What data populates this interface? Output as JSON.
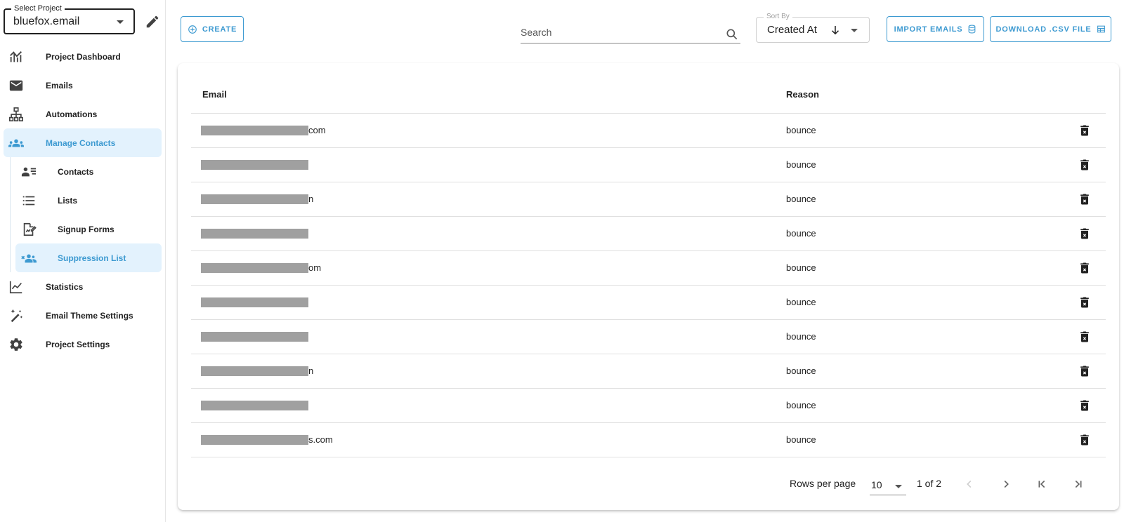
{
  "sidebar": {
    "project_select": {
      "label": "Select Project",
      "value": "bluefox.email"
    },
    "items": [
      {
        "label": "Project Dashboard",
        "icon": "chart-icon"
      },
      {
        "label": "Emails",
        "icon": "mail-icon"
      },
      {
        "label": "Automations",
        "icon": "sitemap-icon"
      },
      {
        "label": "Manage Contacts",
        "icon": "people-icon"
      },
      {
        "label": "Statistics",
        "icon": "line-chart-icon"
      },
      {
        "label": "Email Theme Settings",
        "icon": "magic-wand-icon"
      },
      {
        "label": "Project Settings",
        "icon": "gear-icon"
      }
    ],
    "sub_items": [
      {
        "label": "Contacts",
        "icon": "contact-list-icon"
      },
      {
        "label": "Lists",
        "icon": "list-icon"
      },
      {
        "label": "Signup Forms",
        "icon": "form-icon"
      },
      {
        "label": "Suppression List",
        "icon": "people-remove-icon"
      }
    ]
  },
  "toolbar": {
    "create_label": "CREATE",
    "search_placeholder": "Search",
    "sort": {
      "label": "Sort By",
      "value": "Created At"
    },
    "import_label": "IMPORT EMAILS",
    "download_label": "DOWNLOAD .CSV FILE"
  },
  "table": {
    "columns": {
      "email": "Email",
      "reason": "Reason"
    },
    "rows": [
      {
        "email_tail": "com",
        "reason": "bounce"
      },
      {
        "email_tail": "",
        "reason": "bounce"
      },
      {
        "email_tail": "n",
        "reason": "bounce"
      },
      {
        "email_tail": "",
        "reason": "bounce"
      },
      {
        "email_tail": "om",
        "reason": "bounce"
      },
      {
        "email_tail": "",
        "reason": "bounce"
      },
      {
        "email_tail": "",
        "reason": "bounce"
      },
      {
        "email_tail": "n",
        "reason": "bounce"
      },
      {
        "email_tail": "",
        "reason": "bounce"
      },
      {
        "email_tail": "s.com",
        "reason": "bounce"
      }
    ]
  },
  "pagination": {
    "rows_per_page_label": "Rows per page",
    "rows_per_page_value": "10",
    "range": "1 of 2"
  },
  "colors": {
    "accent": "#3d9ad1",
    "active_bg": "#e3f2fd",
    "redaction": "#a0a0a0"
  }
}
